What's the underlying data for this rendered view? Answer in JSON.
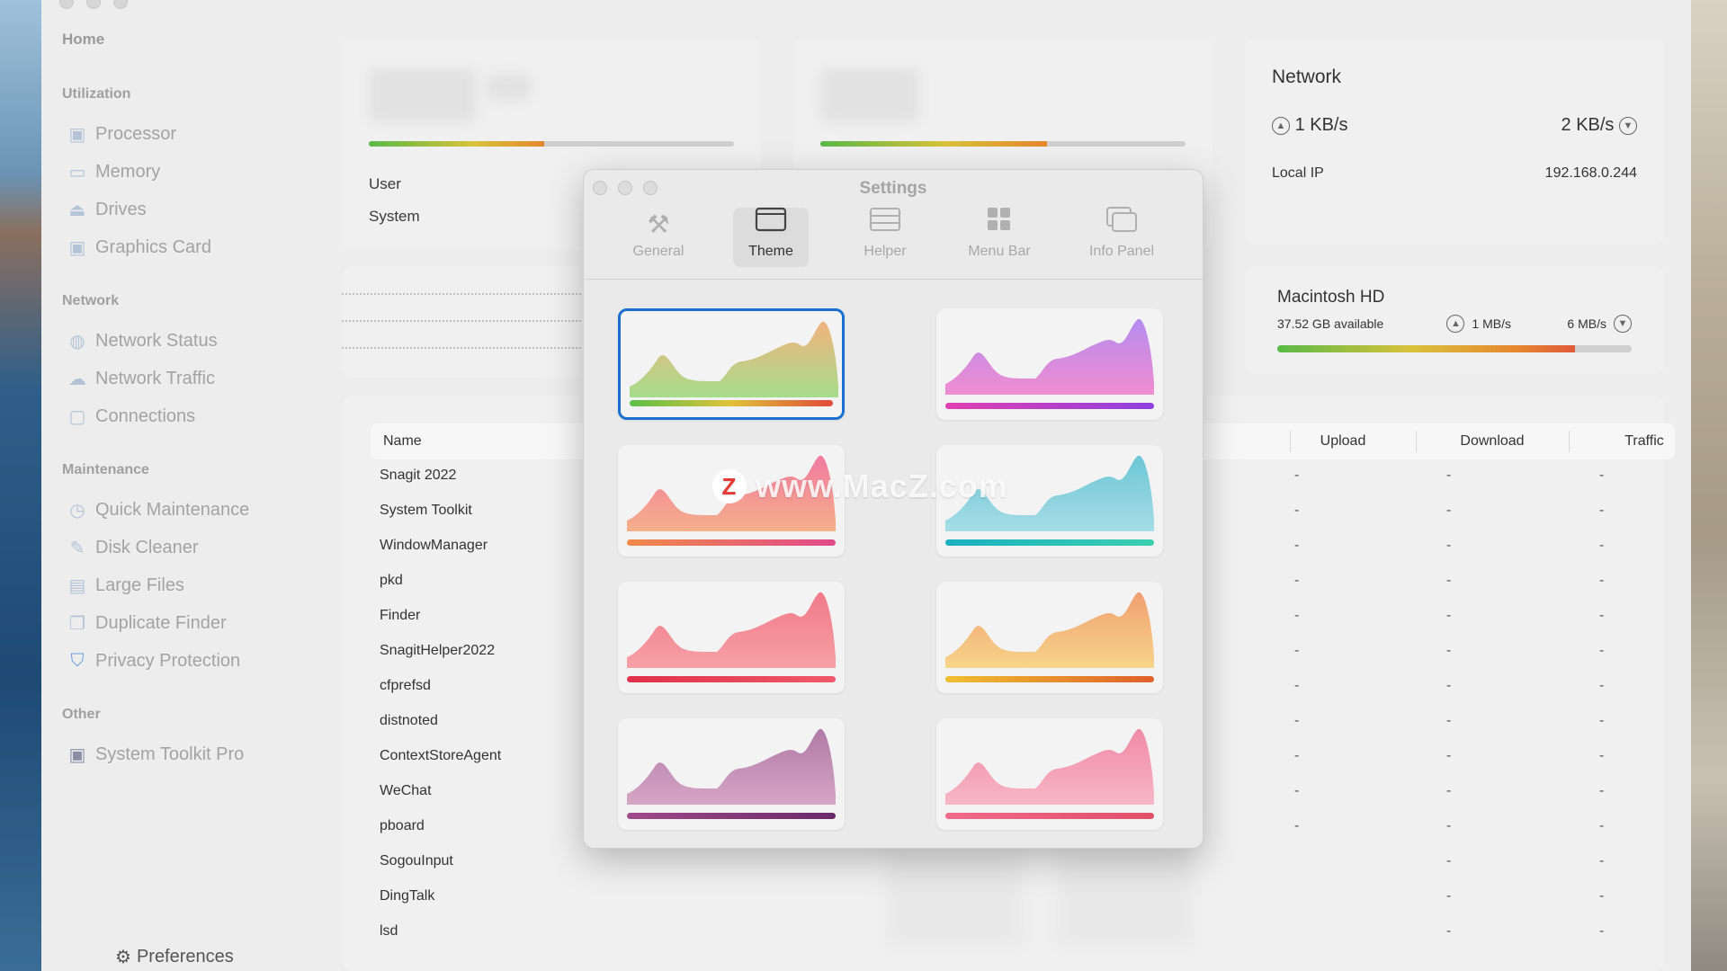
{
  "sidebar": {
    "home": "Home",
    "sections": [
      {
        "title": "Utilization",
        "items": [
          "Processor",
          "Memory",
          "Drives",
          "Graphics Card"
        ]
      },
      {
        "title": "Network",
        "items": [
          "Network Status",
          "Network Traffic",
          "Connections"
        ]
      },
      {
        "title": "Maintenance",
        "items": [
          "Quick Maintenance",
          "Disk Cleaner",
          "Large Files",
          "Duplicate Finder",
          "Privacy Protection"
        ]
      },
      {
        "title": "Other",
        "items": [
          "System Toolkit Pro"
        ]
      }
    ],
    "preferences": "Preferences"
  },
  "cpu_card": {
    "user_label": "User",
    "system_label": "System",
    "load_fraction": 0.48
  },
  "mem_card": {
    "load_fraction": 0.62
  },
  "network": {
    "title": "Network",
    "upload": "1 KB/s",
    "download": "2 KB/s",
    "local_ip_label": "Local IP",
    "local_ip": "192.168.0.244"
  },
  "disk": {
    "title": "Macintosh HD",
    "available": "37.52 GB available",
    "read": "1 MB/s",
    "write": "6 MB/s",
    "used_fraction": 0.84
  },
  "table": {
    "columns": {
      "name": "Name",
      "upload": "Upload",
      "download": "Download",
      "traffic": "Traffic"
    },
    "rows": [
      {
        "name": "Snagit 2022",
        "upload": "-",
        "download": "-",
        "traffic": "-"
      },
      {
        "name": "System Toolkit",
        "upload": "-",
        "download": "-",
        "traffic": "-"
      },
      {
        "name": "WindowManager",
        "upload": "-",
        "download": "-",
        "traffic": "-"
      },
      {
        "name": "pkd",
        "upload": "-",
        "download": "-",
        "traffic": "-"
      },
      {
        "name": "Finder",
        "upload": "-",
        "download": "-",
        "traffic": "-"
      },
      {
        "name": "SnagitHelper2022",
        "upload": "-",
        "download": "-",
        "traffic": "-"
      },
      {
        "name": "cfprefsd",
        "upload": "-",
        "download": "-",
        "traffic": "-"
      },
      {
        "name": "distnoted",
        "upload": "-",
        "download": "-",
        "traffic": "-"
      },
      {
        "name": "ContextStoreAgent",
        "upload": "-",
        "download": "-",
        "traffic": "-"
      },
      {
        "name": "WeChat",
        "upload": "-",
        "download": "-",
        "traffic": "-"
      },
      {
        "name": "pboard",
        "upload": "-",
        "download": "-",
        "traffic": "-"
      },
      {
        "name": "SogouInput",
        "upload": "",
        "download": "-",
        "traffic": "-"
      },
      {
        "name": "DingTalk",
        "upload": "",
        "download": "-",
        "traffic": "-"
      },
      {
        "name": "lsd",
        "upload": "",
        "download": "-",
        "traffic": "-"
      }
    ]
  },
  "settings": {
    "title": "Settings",
    "tabs": [
      {
        "label": "General",
        "icon": "hammer-icon"
      },
      {
        "label": "Theme",
        "icon": "window-icon"
      },
      {
        "label": "Helper",
        "icon": "server-icon"
      },
      {
        "label": "Menu Bar",
        "icon": "grid-icon"
      },
      {
        "label": "Info Panel",
        "icon": "panels-icon"
      }
    ],
    "active_tab": "Theme",
    "themes": [
      {
        "name": "green-orange",
        "fill_top": "#f0b37e",
        "fill_bottom": "#a6dd8a",
        "bar": [
          "#5cc04a",
          "#e0c23a",
          "#e04a3a"
        ],
        "selected": true
      },
      {
        "name": "pink-purple",
        "fill_top": "#b58cf0",
        "fill_bottom": "#f08ccf",
        "bar": [
          "#e040b0",
          "#9040e0"
        ]
      },
      {
        "name": "orange-pink",
        "fill_top": "#f07aa0",
        "fill_bottom": "#f6b08a",
        "bar": [
          "#f08a4a",
          "#e04a8a"
        ]
      },
      {
        "name": "teal",
        "fill_top": "#6cc6d6",
        "fill_bottom": "#a6dde6",
        "bar": [
          "#1ab0c0",
          "#3ad0b0"
        ]
      },
      {
        "name": "coral",
        "fill_top": "#f07a8a",
        "fill_bottom": "#f7a0a6",
        "bar": [
          "#e0304a",
          "#f05a6a"
        ]
      },
      {
        "name": "amber",
        "fill_top": "#f0a070",
        "fill_bottom": "#f7d58a",
        "bar": [
          "#f0c030",
          "#e0602a"
        ]
      },
      {
        "name": "mauve",
        "fill_top": "#b07aa6",
        "fill_bottom": "#d6a6c6",
        "bar": [
          "#a04a8a",
          "#6a2a6a"
        ]
      },
      {
        "name": "rose",
        "fill_top": "#f08aa6",
        "fill_bottom": "#f7b6c6",
        "bar": [
          "#f06a8a",
          "#e0506a"
        ]
      }
    ]
  },
  "watermark": {
    "logo": "Z",
    "text": "www.MacZ.com"
  }
}
